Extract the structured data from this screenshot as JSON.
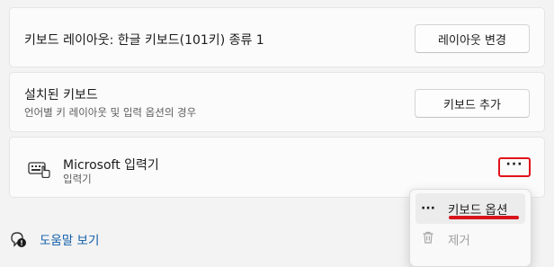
{
  "layout_row": {
    "title": "키보드 레이아웃: 한글 키보드(101키) 종류 1",
    "button": "레이아웃 변경"
  },
  "installed_row": {
    "title": "설치된 키보드",
    "subtitle": "언어별 키 레이아웃 및 입력 옵션의 경우",
    "button": "키보드 추가"
  },
  "ime_row": {
    "title": "Microsoft 입력기",
    "subtitle": "입력기",
    "icon": "keyboard-icon",
    "more_label": "···"
  },
  "help": {
    "label": "도움말 보기",
    "icon": "help-icon"
  },
  "context_menu": {
    "items": [
      {
        "icon": "more-icon",
        "icon_glyph": "···",
        "label": "키보드 옵션",
        "enabled": true
      },
      {
        "icon": "trash-icon",
        "label": "제거",
        "enabled": false
      }
    ]
  },
  "colors": {
    "highlight": "#e0141a",
    "link": "#0f5ca8"
  }
}
